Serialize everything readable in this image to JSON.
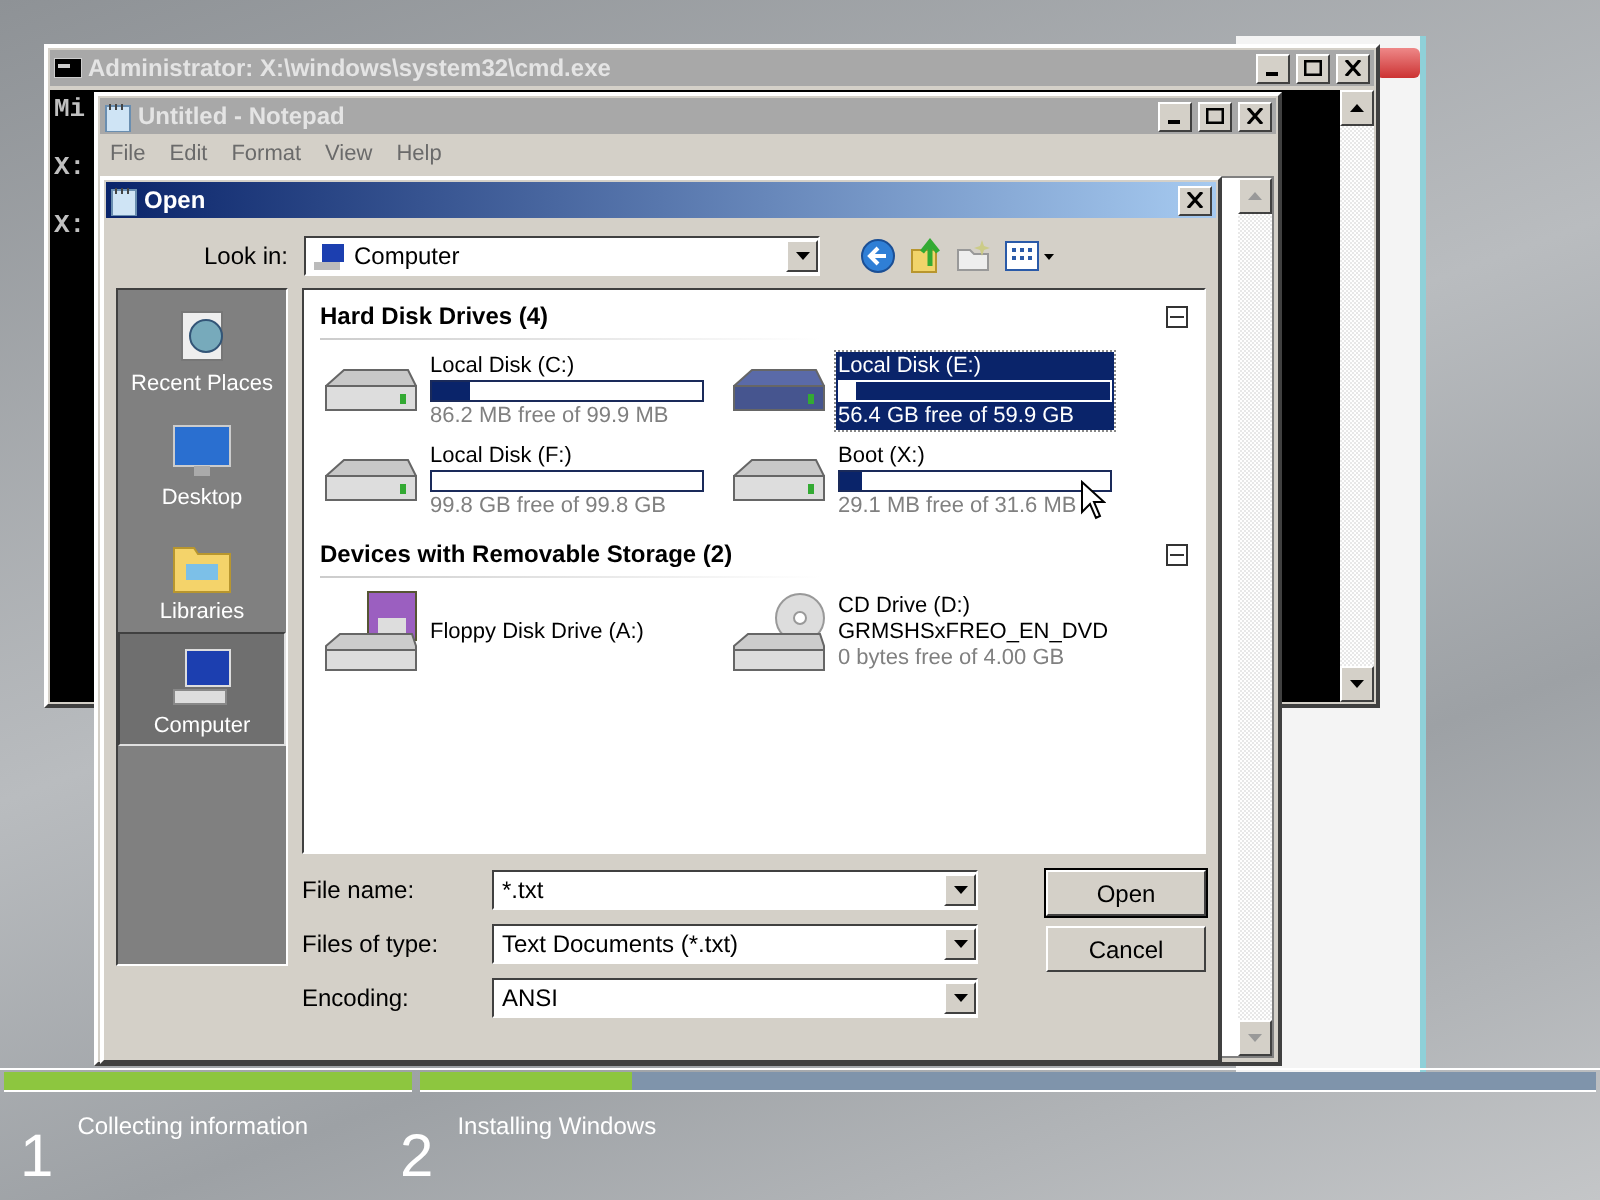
{
  "cmd_window": {
    "title": "Administrator: X:\\windows\\system32\\cmd.exe",
    "lines": [
      "Mi",
      "X:",
      "X:"
    ]
  },
  "notepad": {
    "title": "Untitled - Notepad",
    "menu": [
      "File",
      "Edit",
      "Format",
      "View",
      "Help"
    ]
  },
  "open_dialog": {
    "title": "Open",
    "look_in": {
      "label": "Look in:",
      "value": "Computer"
    },
    "places": [
      {
        "label": "Recent Places",
        "kind": "recent",
        "selected": false
      },
      {
        "label": "Desktop",
        "kind": "desktop",
        "selected": false
      },
      {
        "label": "Libraries",
        "kind": "libraries",
        "selected": false
      },
      {
        "label": "Computer",
        "kind": "computer",
        "selected": true
      }
    ],
    "groups": [
      {
        "title": "Hard Disk Drives (4)",
        "items": [
          {
            "kind": "hard_disk",
            "name": "Local Disk (C:)",
            "level": 0.14,
            "free": "86.2 MB free of 99.9 MB",
            "selected": false
          },
          {
            "kind": "hard_disk",
            "name": "Local Disk (E:)",
            "level": 0.06,
            "free": "56.4 GB free of 59.9 GB",
            "selected": true
          },
          {
            "kind": "hard_disk",
            "name": "Local Disk (F:)",
            "level": 0,
            "free": "99.8 GB free of 99.8 GB",
            "selected": false
          },
          {
            "kind": "hard_disk",
            "name": "Boot (X:)",
            "level": 0.08,
            "free": "29.1 MB free of 31.6 MB",
            "selected": false
          }
        ]
      },
      {
        "title": "Devices with Removable Storage (2)",
        "items": [
          {
            "kind": "floppy",
            "name": "Floppy Disk Drive (A:)",
            "selected": false
          },
          {
            "kind": "cd",
            "name": "CD Drive (D:)",
            "subtitle": "GRMSHSxFREO_EN_DVD",
            "free": "0 bytes free of 4.00 GB",
            "selected": false
          }
        ]
      }
    ],
    "fields": [
      {
        "label": "File name:",
        "value": "*.txt"
      },
      {
        "label": "Files of type:",
        "value": "Text Documents (*.txt)"
      },
      {
        "label": "Encoding:",
        "value": "ANSI"
      }
    ],
    "buttons": [
      "Open",
      "Cancel"
    ]
  },
  "setup_steps": [
    {
      "number": "1",
      "label": "Collecting information",
      "level": 1
    },
    {
      "number": "2",
      "label": "Installing Windows",
      "level": 0.18
    }
  ]
}
